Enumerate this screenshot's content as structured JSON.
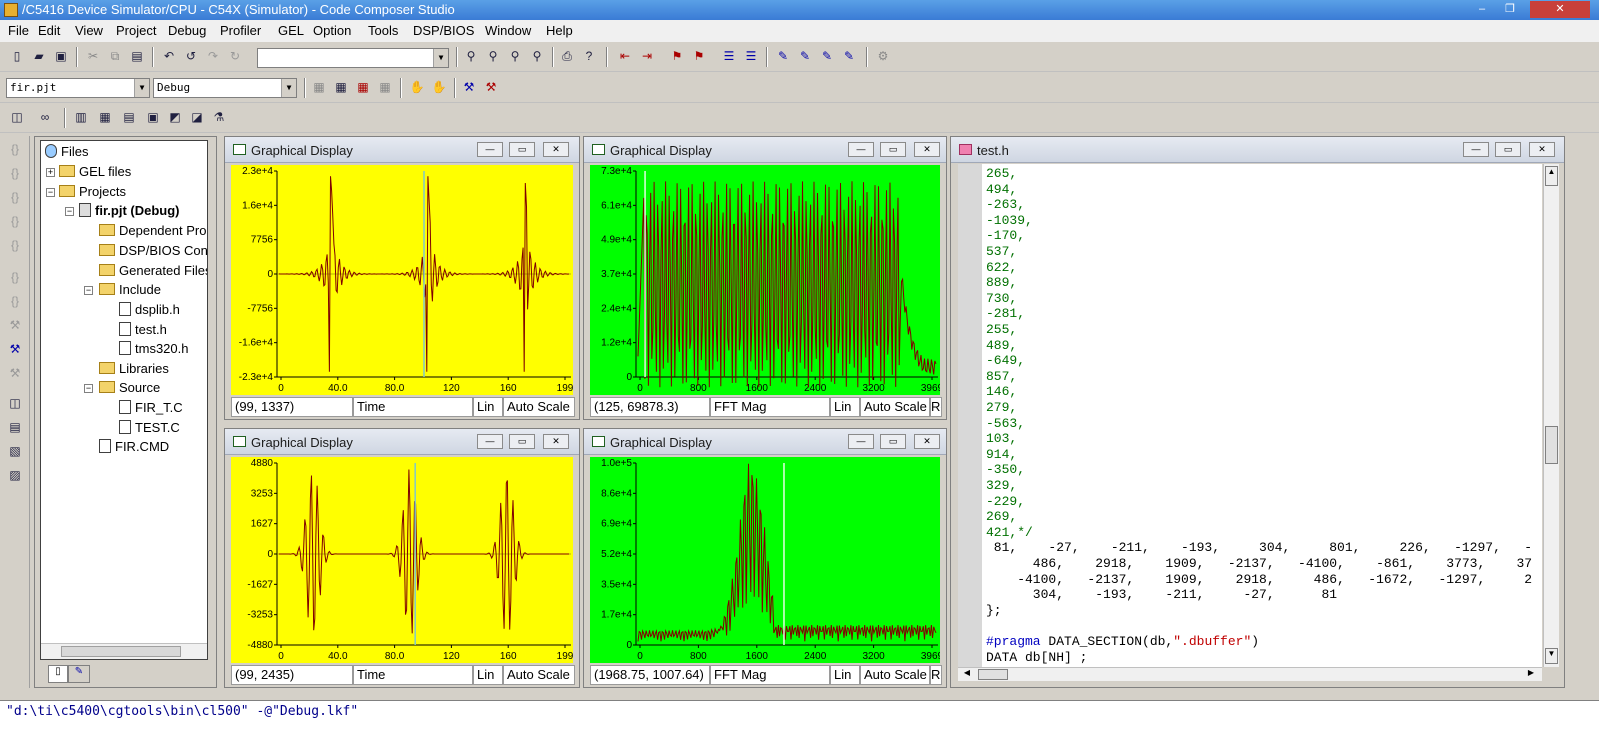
{
  "window": {
    "title": "/C5416 Device Simulator/CPU - C54X (Simulator) - Code Composer Studio",
    "controls": [
      "–",
      "❐",
      "✕"
    ]
  },
  "menu": [
    "File",
    "Edit",
    "View",
    "Project",
    "Debug",
    "Profiler",
    "GEL",
    "Option",
    "Tools",
    "DSP/BIOS",
    "Window",
    "Help"
  ],
  "toolbar": {
    "project_combo": "fir.pjt",
    "config_combo": "Debug",
    "find_combo": ""
  },
  "project_tree": {
    "root": "Files",
    "gel": "GEL files",
    "projects": "Projects",
    "project": "fir.pjt (Debug)",
    "dependent": "Dependent Pro",
    "dspbios": "DSP/BIOS Conf",
    "generated": "Generated Files",
    "include": "Include",
    "include_files": [
      "dsplib.h",
      "test.h",
      "tms320.h"
    ],
    "libraries": "Libraries",
    "source": "Source",
    "source_files": [
      "FIR_T.C",
      "TEST.C"
    ],
    "cmd": "FIR.CMD"
  },
  "graphs": [
    {
      "title": "Graphical Display",
      "bg": "#ffff00",
      "yticks": [
        "2.3e+4",
        "1.6e+4",
        "7756",
        "0",
        "-7756",
        "-1.6e+4",
        "-2.3e+4"
      ],
      "xticks": [
        "0",
        "40.0",
        "80.0",
        "120",
        "160",
        "199"
      ],
      "status": [
        "(99, 1337)",
        "Time",
        "Lin",
        "Auto Scale"
      ]
    },
    {
      "title": "Graphical Display",
      "bg": "#00ff00",
      "yticks": [
        "7.3e+4",
        "6.1e+4",
        "4.9e+4",
        "3.7e+4",
        "2.4e+4",
        "1.2e+4",
        "0"
      ],
      "xticks": [
        "0",
        "800",
        "1600",
        "2400",
        "3200",
        "3969"
      ],
      "status": [
        "(125, 69878.3)",
        "FFT Mag",
        "Lin",
        "Auto Scale",
        "Re"
      ]
    },
    {
      "title": "Graphical Display",
      "bg": "#ffff00",
      "yticks": [
        "4880",
        "3253",
        "1627",
        "0",
        "-1627",
        "-3253",
        "-4880"
      ],
      "xticks": [
        "0",
        "40.0",
        "80.0",
        "120",
        "160",
        "199"
      ],
      "status": [
        "(99, 2435)",
        "Time",
        "Lin",
        "Auto Scale"
      ]
    },
    {
      "title": "Graphical Display",
      "bg": "#00ff00",
      "yticks": [
        "1.0e+5",
        "8.6e+4",
        "6.9e+4",
        "5.2e+4",
        "3.5e+4",
        "1.7e+4",
        "0"
      ],
      "xticks": [
        "0",
        "800",
        "1600",
        "2400",
        "3200",
        "3969"
      ],
      "status": [
        "(1968.75, 1007.64)",
        "FFT Mag",
        "Lin",
        "Auto Scale",
        "Re"
      ]
    }
  ],
  "editor": {
    "title": "test.h",
    "green_lines": [
      "265,",
      "494,",
      "-263,",
      "-1039,",
      "-170,",
      "537,",
      "622,",
      "889,",
      "730,",
      "-281,",
      "255,",
      "489,",
      "-649,",
      "857,",
      "146,",
      "279,",
      "-563,",
      "103,",
      "914,",
      "-350,",
      "329,",
      "-229,",
      "269,",
      "421,*/"
    ],
    "code_lines": [
      " 81,    -27,    -211,    -193,     304,     801,     226,   -1297,   -",
      "      486,    2918,    1909,   -2137,   -4100,    -861,    3773,    37",
      "    -4100,   -2137,    1909,    2918,     486,   -1672,   -1297,     2",
      "      304,    -193,    -211,     -27,      81",
      "};"
    ],
    "pragma_kw": "#pragma",
    "pragma_mid": " DATA_SECTION(db,",
    "pragma_str": "\".dbuffer\"",
    "pragma_end": ")",
    "last_line": "DATA db[NH] ;"
  },
  "command_line": "\"d:\\ti\\c5400\\cgtools\\bin\\cl500\" -@\"Debug.lkf\""
}
